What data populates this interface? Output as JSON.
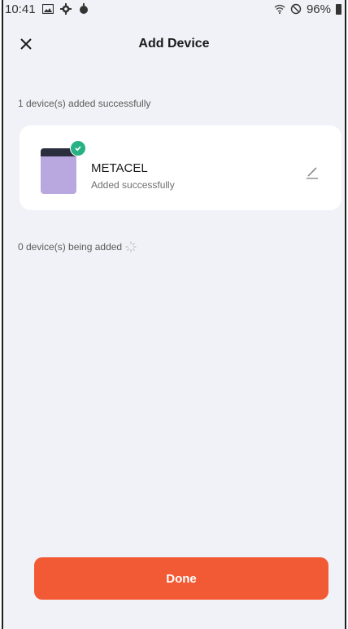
{
  "status_bar": {
    "time": "10:41",
    "battery": "96%",
    "icons_left": [
      "gallery-icon",
      "settings-icon",
      "timer-icon"
    ],
    "icons_right": [
      "wifi-icon",
      "do-not-disturb-icon",
      "battery-icon"
    ]
  },
  "header": {
    "title": "Add Device",
    "close_icon": "close-icon"
  },
  "success_section": {
    "label": "1 device(s) added successfully"
  },
  "device": {
    "name": "METACEL",
    "status": "Added successfully",
    "edit_icon": "pencil-icon",
    "badge_icon": "check-icon"
  },
  "adding_section": {
    "label": "0 device(s) being added",
    "spinner_icon": "loading-spinner-icon"
  },
  "footer": {
    "done_label": "Done"
  },
  "colors": {
    "accent": "#f25a35",
    "success": "#27b285",
    "background": "#f1f2f7"
  }
}
